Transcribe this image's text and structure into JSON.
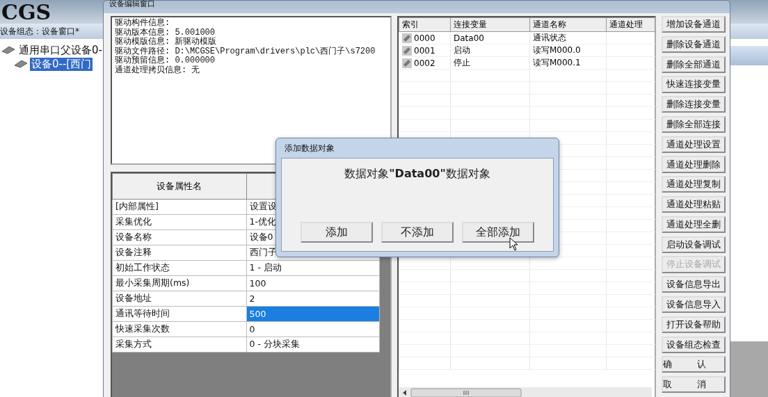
{
  "banner": {
    "logo": "CGS"
  },
  "main_window": {
    "subtitle": "设备组态：设备窗口*",
    "tree": [
      {
        "label": "通用串口父设备0-",
        "selected": false,
        "children": [
          {
            "label": "设备0--[西门",
            "selected": true
          }
        ]
      }
    ]
  },
  "editor": {
    "title": "设备编辑窗口",
    "driver_info": [
      "驱动构件信息:",
      "驱动版本信息: 5.001000",
      "驱动模版信息: 新驱动模版",
      "驱动文件路径: D:\\MCGSE\\Program\\drivers\\plc\\西门子\\s7200",
      "驱动预留信息: 0.000000",
      "通道处理拷贝信息: 无"
    ],
    "properties": {
      "columns": [
        "设备属性名"
      ],
      "rows": [
        {
          "name": "[内部属性]",
          "value": "设置设",
          "selected": false
        },
        {
          "name": "采集优化",
          "value": "1-优化",
          "selected": false
        },
        {
          "name": "设备名称",
          "value": "设备0",
          "selected": false
        },
        {
          "name": "设备注释",
          "value": "西门子",
          "selected": false
        },
        {
          "name": "初始工作状态",
          "value": "1 - 启动",
          "selected": false
        },
        {
          "name": "最小采集周期(ms)",
          "value": "100",
          "selected": false
        },
        {
          "name": "设备地址",
          "value": "2",
          "selected": false
        },
        {
          "name": "通讯等待时间",
          "value": "500",
          "selected": true
        },
        {
          "name": "快速采集次数",
          "value": "0",
          "selected": false
        },
        {
          "name": "采集方式",
          "value": "0 - 分块采集",
          "selected": false
        }
      ]
    },
    "channels": {
      "columns": [
        "索引",
        "连接变量",
        "通道名称",
        "通道处理"
      ],
      "rows": [
        {
          "index": "0000",
          "variable": "Data00",
          "name": "通讯状态"
        },
        {
          "index": "0001",
          "variable": "启动",
          "name": "读写M000.0"
        },
        {
          "index": "0002",
          "variable": "停止",
          "name": "读写M000.1"
        }
      ]
    },
    "buttons": [
      {
        "label": "增加设备通道",
        "disabled": false
      },
      {
        "label": "删除设备通道",
        "disabled": false
      },
      {
        "label": "删除全部通道",
        "disabled": false
      },
      {
        "label": "快速连接变量",
        "disabled": false
      },
      {
        "label": "删除连接变量",
        "disabled": false
      },
      {
        "label": "删除全部连接",
        "disabled": false
      },
      {
        "label": "通道处理设置",
        "disabled": false
      },
      {
        "label": "通道处理删除",
        "disabled": false
      },
      {
        "label": "通道处理复制",
        "disabled": false
      },
      {
        "label": "通道处理粘贴",
        "disabled": false
      },
      {
        "label": "通道处理全删",
        "disabled": false
      },
      {
        "label": "启动设备调试",
        "disabled": false
      },
      {
        "label": "停止设备调试",
        "disabled": true
      },
      {
        "label": "设备信息导出",
        "disabled": false
      },
      {
        "label": "设备信息导入",
        "disabled": false
      },
      {
        "label": "打开设备帮助",
        "disabled": false
      },
      {
        "label": "设备组态检查",
        "disabled": false
      },
      {
        "label": "确认",
        "disabled": false
      },
      {
        "label": "取消",
        "disabled": false
      }
    ]
  },
  "dialog": {
    "title": "添加数据对象",
    "message": "数据对象**\"Data00\"**数据对象",
    "buttons": [
      {
        "label": "添加"
      },
      {
        "label": "不添加"
      },
      {
        "label": "全部添加"
      }
    ]
  }
}
